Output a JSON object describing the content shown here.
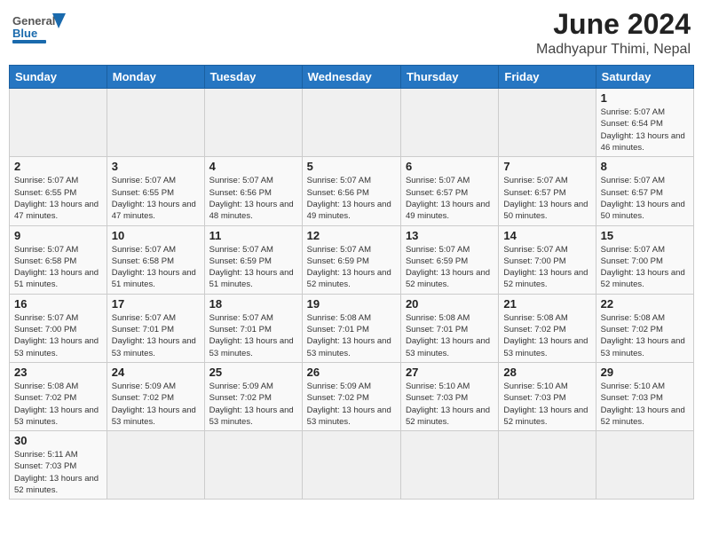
{
  "header": {
    "logo_general": "General",
    "logo_blue": "Blue",
    "title": "June 2024",
    "subtitle": "Madhyapur Thimi, Nepal"
  },
  "weekdays": [
    "Sunday",
    "Monday",
    "Tuesday",
    "Wednesday",
    "Thursday",
    "Friday",
    "Saturday"
  ],
  "weeks": [
    [
      {
        "day": null
      },
      {
        "day": null
      },
      {
        "day": null
      },
      {
        "day": null
      },
      {
        "day": null
      },
      {
        "day": null
      },
      {
        "day": "1",
        "sunrise": "5:07 AM",
        "sunset": "6:54 PM",
        "daylight": "13 hours and 46 minutes."
      }
    ],
    [
      {
        "day": "2",
        "sunrise": "5:07 AM",
        "sunset": "6:55 PM",
        "daylight": "13 hours and 47 minutes."
      },
      {
        "day": "3",
        "sunrise": "5:07 AM",
        "sunset": "6:55 PM",
        "daylight": "13 hours and 47 minutes."
      },
      {
        "day": "4",
        "sunrise": "5:07 AM",
        "sunset": "6:56 PM",
        "daylight": "13 hours and 48 minutes."
      },
      {
        "day": "5",
        "sunrise": "5:07 AM",
        "sunset": "6:56 PM",
        "daylight": "13 hours and 49 minutes."
      },
      {
        "day": "6",
        "sunrise": "5:07 AM",
        "sunset": "6:57 PM",
        "daylight": "13 hours and 49 minutes."
      },
      {
        "day": "7",
        "sunrise": "5:07 AM",
        "sunset": "6:57 PM",
        "daylight": "13 hours and 50 minutes."
      },
      {
        "day": "8",
        "sunrise": "5:07 AM",
        "sunset": "6:57 PM",
        "daylight": "13 hours and 50 minutes."
      }
    ],
    [
      {
        "day": "9",
        "sunrise": "5:07 AM",
        "sunset": "6:58 PM",
        "daylight": "13 hours and 51 minutes."
      },
      {
        "day": "10",
        "sunrise": "5:07 AM",
        "sunset": "6:58 PM",
        "daylight": "13 hours and 51 minutes."
      },
      {
        "day": "11",
        "sunrise": "5:07 AM",
        "sunset": "6:59 PM",
        "daylight": "13 hours and 51 minutes."
      },
      {
        "day": "12",
        "sunrise": "5:07 AM",
        "sunset": "6:59 PM",
        "daylight": "13 hours and 52 minutes."
      },
      {
        "day": "13",
        "sunrise": "5:07 AM",
        "sunset": "6:59 PM",
        "daylight": "13 hours and 52 minutes."
      },
      {
        "day": "14",
        "sunrise": "5:07 AM",
        "sunset": "7:00 PM",
        "daylight": "13 hours and 52 minutes."
      },
      {
        "day": "15",
        "sunrise": "5:07 AM",
        "sunset": "7:00 PM",
        "daylight": "13 hours and 52 minutes."
      }
    ],
    [
      {
        "day": "16",
        "sunrise": "5:07 AM",
        "sunset": "7:00 PM",
        "daylight": "13 hours and 53 minutes."
      },
      {
        "day": "17",
        "sunrise": "5:07 AM",
        "sunset": "7:01 PM",
        "daylight": "13 hours and 53 minutes."
      },
      {
        "day": "18",
        "sunrise": "5:07 AM",
        "sunset": "7:01 PM",
        "daylight": "13 hours and 53 minutes."
      },
      {
        "day": "19",
        "sunrise": "5:08 AM",
        "sunset": "7:01 PM",
        "daylight": "13 hours and 53 minutes."
      },
      {
        "day": "20",
        "sunrise": "5:08 AM",
        "sunset": "7:01 PM",
        "daylight": "13 hours and 53 minutes."
      },
      {
        "day": "21",
        "sunrise": "5:08 AM",
        "sunset": "7:02 PM",
        "daylight": "13 hours and 53 minutes."
      },
      {
        "day": "22",
        "sunrise": "5:08 AM",
        "sunset": "7:02 PM",
        "daylight": "13 hours and 53 minutes."
      }
    ],
    [
      {
        "day": "23",
        "sunrise": "5:08 AM",
        "sunset": "7:02 PM",
        "daylight": "13 hours and 53 minutes."
      },
      {
        "day": "24",
        "sunrise": "5:09 AM",
        "sunset": "7:02 PM",
        "daylight": "13 hours and 53 minutes."
      },
      {
        "day": "25",
        "sunrise": "5:09 AM",
        "sunset": "7:02 PM",
        "daylight": "13 hours and 53 minutes."
      },
      {
        "day": "26",
        "sunrise": "5:09 AM",
        "sunset": "7:02 PM",
        "daylight": "13 hours and 53 minutes."
      },
      {
        "day": "27",
        "sunrise": "5:10 AM",
        "sunset": "7:03 PM",
        "daylight": "13 hours and 52 minutes."
      },
      {
        "day": "28",
        "sunrise": "5:10 AM",
        "sunset": "7:03 PM",
        "daylight": "13 hours and 52 minutes."
      },
      {
        "day": "29",
        "sunrise": "5:10 AM",
        "sunset": "7:03 PM",
        "daylight": "13 hours and 52 minutes."
      }
    ],
    [
      {
        "day": "30",
        "sunrise": "5:11 AM",
        "sunset": "7:03 PM",
        "daylight": "13 hours and 52 minutes."
      },
      {
        "day": null
      },
      {
        "day": null
      },
      {
        "day": null
      },
      {
        "day": null
      },
      {
        "day": null
      },
      {
        "day": null
      }
    ]
  ],
  "labels": {
    "sunrise": "Sunrise:",
    "sunset": "Sunset:",
    "daylight": "Daylight:"
  }
}
